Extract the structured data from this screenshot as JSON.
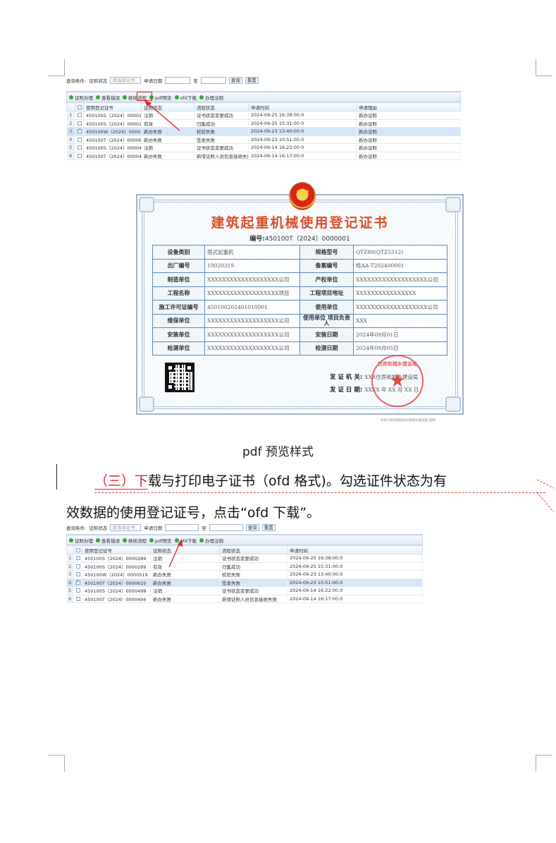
{
  "grid1": {
    "query_label": "查询条件:",
    "status_label": "证照状态",
    "status_placeholder": "请选择证书",
    "date_label": "申请日期",
    "to_label": "至",
    "search_btn": "查询",
    "reset_btn": "重置",
    "toolbar": [
      "证照办理",
      "查看错误",
      "继续流程",
      "pdf预览",
      "ofd下载",
      "办理注销"
    ],
    "columns": [
      "使用登记证号",
      "证照状态",
      "流程状态",
      "申请时间",
      "申请理由"
    ],
    "rows": [
      {
        "n": "1",
        "checked": false,
        "no": "450100S（2024）0000289",
        "status": "注销",
        "flow": "证书状态变更成功",
        "time": "2024-09-25 16:38:00.0",
        "reason": "新办证照"
      },
      {
        "n": "2",
        "checked": false,
        "no": "450100S（2024）0000289",
        "status": "有效",
        "flow": "归集成功",
        "time": "2024-09-25 15:31:00.0",
        "reason": "新办证照"
      },
      {
        "n": "3",
        "checked": true,
        "no": "450100W（2024）0000519",
        "status": "新办失败",
        "flow": "校验失败",
        "time": "2024-09-23 13:40:00.0",
        "reason": "新办证照"
      },
      {
        "n": "4",
        "checked": false,
        "no": "450100T（2024）0000619",
        "status": "新办失败",
        "flow": "签发失败",
        "time": "2024-09-23 10:51:00.0",
        "reason": "新办证照"
      },
      {
        "n": "5",
        "checked": false,
        "no": "450100S（2024）0000499",
        "status": "注销",
        "flow": "证书状态变更成功",
        "time": "2024-09-14 16:22:00.0",
        "reason": "新办证照"
      },
      {
        "n": "6",
        "checked": false,
        "no": "450100T（2024）0000494",
        "status": "新办失败",
        "flow": "新增证照人员信息接收失败",
        "time": "2024-09-14 16:17:00.0",
        "reason": "新办证照"
      }
    ]
  },
  "cert": {
    "title": "建筑起重机械使用登记证书",
    "no_label": "编号:",
    "no_value": "450100T（2024）0000001",
    "rows": [
      [
        "设备类别",
        "塔式起重机",
        "规格型号",
        "QTZ80(QTZ5512)"
      ],
      [
        "出厂编号",
        "19020319",
        "备案编号",
        "桂AA-T202400001"
      ],
      [
        "制造单位",
        "XXXXXXXXXXXXXXXXXXX公司",
        "产权单位",
        "XXXXXXXXXXXXXXXXXXX公司"
      ],
      [
        "工程名称",
        "XXXXXXXXXXXXXXXXXXX项目",
        "工程项目地址",
        "XXXXXXXXXXXXXXXX"
      ],
      [
        "施工许可证编号",
        "450100202401010001",
        "使用单位",
        "XXXXXXXXXXXXXXXXXXX公司"
      ],
      [
        "维保单位",
        "XXXXXXXXXXXXXXXXXXX公司",
        "使用单位 项目负责人",
        "XXX"
      ],
      [
        "安装单位",
        "XXXXXXXXXXXXXXXXXXX公司",
        "安装日期",
        "2024年09月01日"
      ],
      [
        "检测单位",
        "XXXXXXXXXXXXXXXXXXX公司",
        "检测日期",
        "2024年09月05日"
      ]
    ],
    "issuer_label": "发 证 机 关:",
    "issuer_value": "XXX住房和城乡建设局",
    "date_label": "发 证 日 期:",
    "date_value": "XXXX 年 XX 月 XX 日",
    "seal_text": "住房和城乡建设局",
    "footnote": "中华人民共和国住房和城乡建设部 监制"
  },
  "caption": "pdf 预览样式",
  "para": {
    "num": "（三）下",
    "line1_rest": "载与打印电子证书（ofd 格式)。勾选证件状态为有",
    "line2": "效数据的使用登记证号，点击“ofd 下载”。"
  },
  "grid2": {
    "query_label": "查询条件:",
    "status_label": "证照状态",
    "status_placeholder": "请选择证书",
    "date_label": "申请日期",
    "to_label": "至",
    "search_btn": "查询",
    "reset_btn": "重置",
    "toolbar": [
      "证照办理",
      "查看错误",
      "继续流程",
      "pdf预览",
      "ofd下载",
      "办理注销"
    ],
    "columns": [
      "使用登记证号",
      "证照状态",
      "流程状态",
      "申请时间"
    ],
    "rows": [
      {
        "n": "1",
        "checked": false,
        "no": "450100S（2024）0000289",
        "status": "注销",
        "flow": "证书状态变更成功",
        "time": "2024-09-25 16:38:00.0"
      },
      {
        "n": "2",
        "checked": false,
        "no": "450100S（2024）0000289",
        "status": "有效",
        "flow": "归集成功",
        "time": "2024-09-25 15:31:00.0"
      },
      {
        "n": "3",
        "checked": false,
        "no": "450100W（2024）0000519",
        "status": "新办失败",
        "flow": "校验失败",
        "time": "2024-09-23 13:40:00.0"
      },
      {
        "n": "4",
        "checked": true,
        "no": "450100T（2024）0000619",
        "status": "新办失败",
        "flow": "签发失败",
        "time": "2024-09-23 10:51:00.0"
      },
      {
        "n": "5",
        "checked": false,
        "no": "450100S（2024）0000499",
        "status": "注销",
        "flow": "证书状态变更成功",
        "time": "2024-09-14 16:22:00.0"
      },
      {
        "n": "6",
        "checked": false,
        "no": "450100T（2024）0000494",
        "status": "新办失败",
        "flow": "新增证照人员信息接收失败",
        "time": "2024-09-14 16:17:00.0"
      }
    ]
  }
}
